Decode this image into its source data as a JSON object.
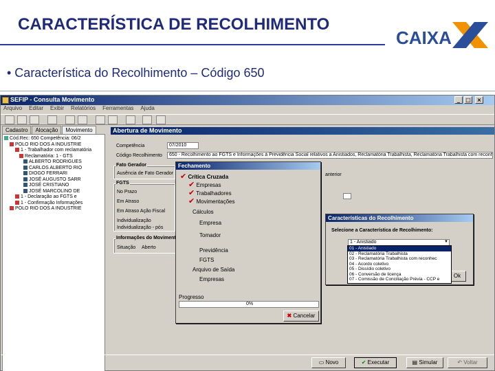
{
  "slide": {
    "title": "CARACTERÍSTICA DE RECOLHIMENTO",
    "logo_text": "CAIXA",
    "bullet": "• Característica do Recolhimento – Código 650",
    "colors": {
      "title": "#1f2a7a",
      "logo_blue": "#2b4e9b",
      "logo_orange": "#f39200"
    }
  },
  "window": {
    "title": "SEFIP - Consulta Movimento",
    "menu": [
      "Arquivo",
      "Editar",
      "Exibir",
      "Relatórios",
      "Ferramentas",
      "Ajuda"
    ],
    "tabs": [
      "Cadastro",
      "Alocação",
      "Movimento"
    ],
    "tree": [
      "Cód.Rec: 650 Competência: 06/2",
      "POLO RIO DOS A INDUSTRIE",
      "1 - Trabalhador com reclamatória",
      "Reclamatória: 1 - GTS",
      "ALBERTO RODRIGUES",
      "CARLOS ALBERTO RIO",
      "DIOGO FERRARI",
      "JOSÉ AUGUSTO SARR",
      "JOSÉ CRISTIANO",
      "JOSÉ MARCOLINO DE",
      "1 - Declaração ao FGTS e",
      "1 - Confirmação Informações",
      "POLO RIO DOS A INDUSTRIE"
    ],
    "panel": {
      "header": "Abertura de Movimento",
      "competencia_label": "Competência",
      "competencia_value": "07/2010",
      "codigo_label": "Código Recolhimento",
      "codigo_value": "650 - Recolhimento ao FGTS e Informações à Previdência Social relativos a Anistiados, Reclamatória Trabalhista, Reclamatória Trabalhista com reconh.",
      "fato_label": "Fato Gerador",
      "fato_value": "Ausência de Fato Gerador",
      "anterior_label": "anterior",
      "fgts_label": "FGTS",
      "fgts_options": [
        "No Prazo",
        "Em Atraso",
        "Em Atraso Ação Fiscal",
        "Individualização",
        "Individualização - pós"
      ],
      "info_label": "Informações do Movimento",
      "situacao_label": "Situação",
      "situacao_value": "Aberto"
    },
    "fechamento": {
      "title": "Fechamento",
      "items": [
        "Crítica Cruzada",
        "Empresas",
        "Trabalhadores",
        "Movimentações"
      ],
      "calculos_label": "Cálculos",
      "calculos": [
        "Empresa",
        "Tomador",
        "Previdência",
        "FGTS"
      ],
      "arquivo_label": "Arquivo de Saída",
      "arquivo": [
        "Empresas"
      ],
      "progresso_label": "Progresso",
      "progresso_value": "0%",
      "progresso_fraction": 0,
      "cancel_label": "Cancelar"
    },
    "caracteristicas": {
      "title": "Características do Recolhimento",
      "prompt": "Selecione a Característica de Recolhimento:",
      "selected": "1 - Anistiado",
      "options": [
        "01 - Anistiado",
        "02 - Reclamatória Trabalhista",
        "03 - Reclamatória Trabalhista com reconhec",
        "04 - Acordo coletivo",
        "05 - Dissídio coletivo",
        "06 - Conversão de licença",
        "07 - Comissão de Conciliação Prévia - CCP e"
      ],
      "side_btn": "Ok"
    },
    "footer_buttons": [
      "Novo",
      "Executar",
      "Simular",
      "Voltar"
    ]
  }
}
